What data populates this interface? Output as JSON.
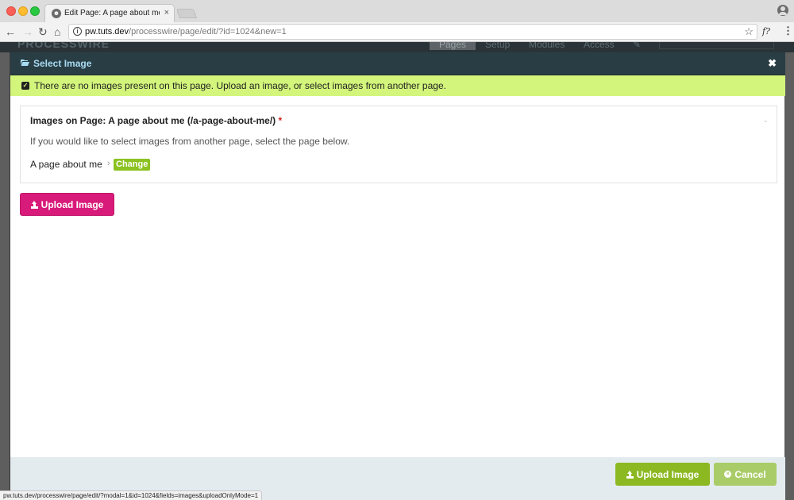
{
  "browser": {
    "tab_title": "Edit Page: A page about me • p",
    "tab_close": "×",
    "url_host": "pw.tuts.dev",
    "url_path": "/processwire/page/edit/?id=1024&new=1",
    "extension_label": "f?",
    "status_url": "pw.tuts.dev/processwire/page/edit/?modal=1&id=1024&fields=images&uploadOnlyMode=1"
  },
  "site": {
    "logo": "PROCESSWIRE",
    "nav": [
      "Pages",
      "Setup",
      "Modules",
      "Access"
    ],
    "active_nav": "Pages"
  },
  "modal": {
    "title": "Select Image",
    "close_label": "✖",
    "alert": "There are no images present on this page. Upload an image, or select images from another page.",
    "field": {
      "label": "Images on Page: A page about me (/a-page-about-me/)",
      "required_mark": "*",
      "description": "If you would like to select images from another page, select the page below.",
      "page_name": "A page about me",
      "separator": "›",
      "change_label": "Change"
    },
    "upload_button": "Upload Image",
    "footer": {
      "upload_button": "Upload Image",
      "cancel_button": "Cancel"
    }
  },
  "colors": {
    "titlebar": "#293d44",
    "title_text": "#a8dcf2",
    "alert_bg": "#d3f57b",
    "pink_button": "#d81b7a",
    "green_button": "#8cb822",
    "cancel_button": "#a9cc68",
    "change_badge": "#8cc221",
    "footer_bg": "#e4ebef"
  }
}
